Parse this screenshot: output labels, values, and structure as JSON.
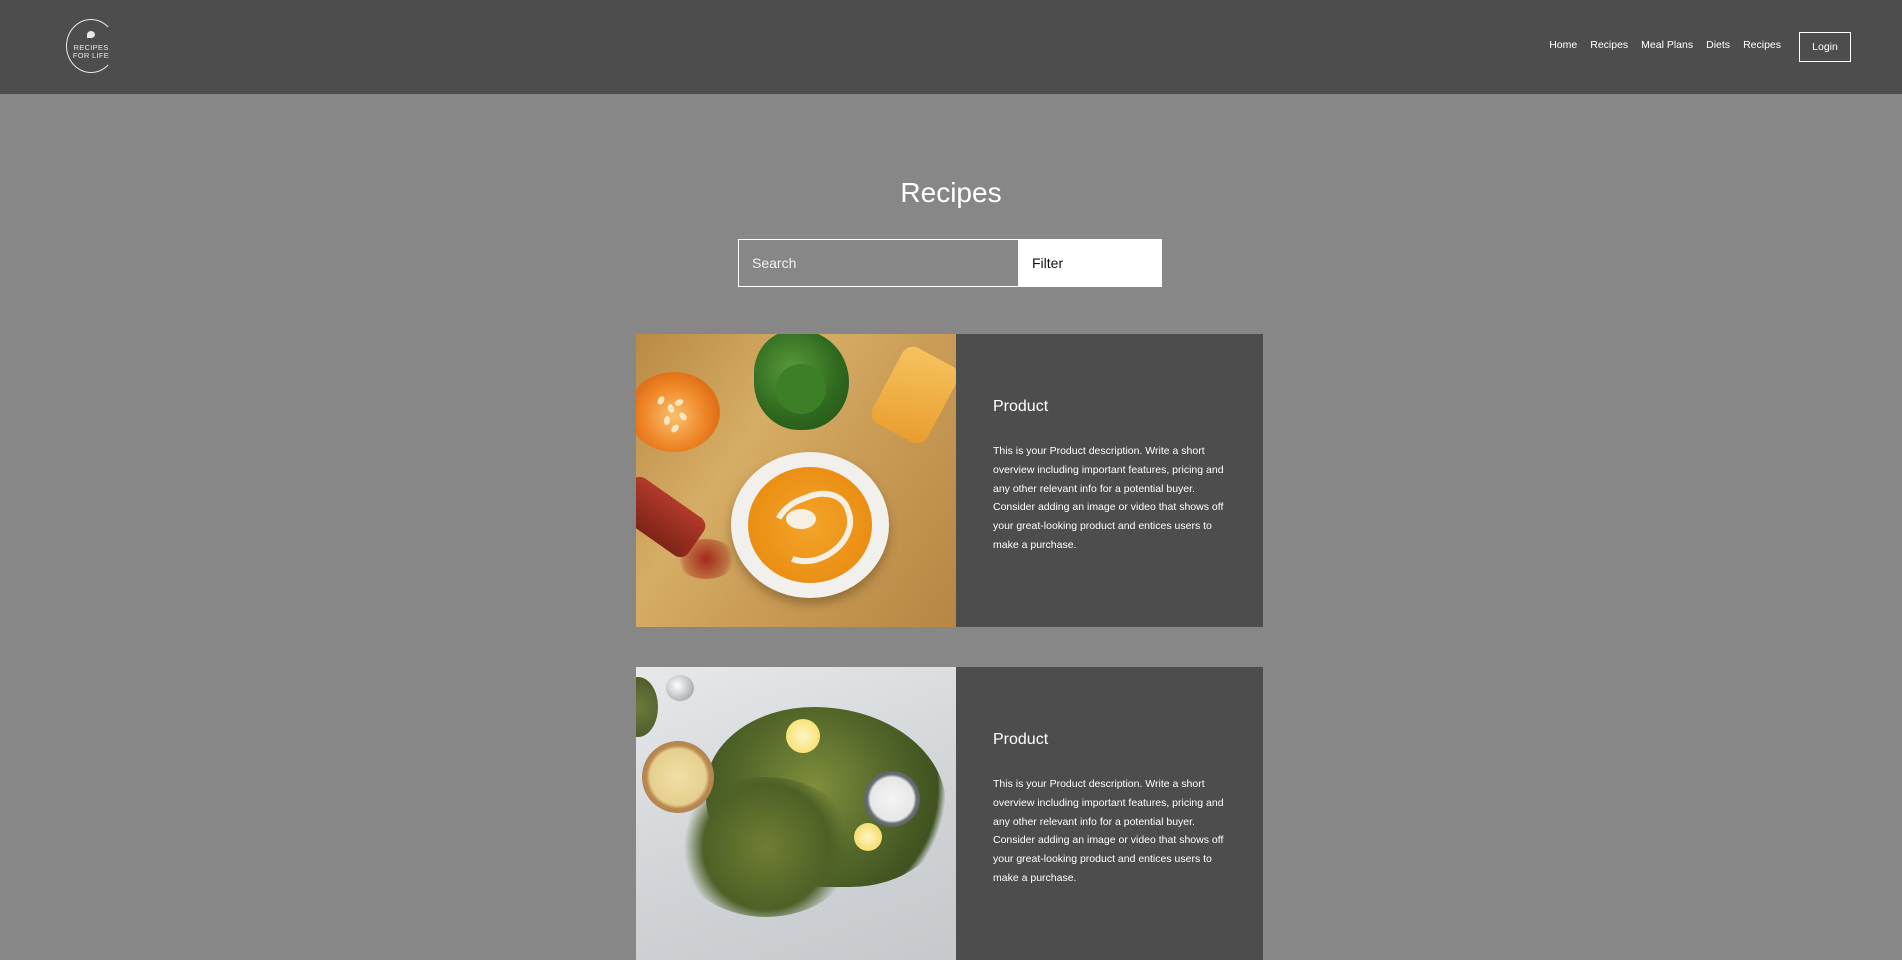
{
  "header": {
    "logo_text": "RECIPES FOR LIFE",
    "nav": [
      "Home",
      "Recipes",
      "Meal Plans",
      "Diets",
      "Recipes"
    ],
    "login_label": "Login"
  },
  "main": {
    "title": "Recipes",
    "search": {
      "placeholder": "Search",
      "value": ""
    },
    "filter_label": "Filter",
    "cards": [
      {
        "image": "butternut-squash-soup-image",
        "title": "Product",
        "description": "This is your Product description. Write a short overview including important features, pricing and any other relevant info for a potential buyer. Consider adding an image or video that shows off your great-looking product and entices users to make a purchase."
      },
      {
        "image": "fried-greens-with-aioli-image",
        "title": "Product",
        "description": "This is your Product description. Write a short overview including important features, pricing and any other relevant info for a potential buyer. Consider adding an image or video that shows off your great-looking product and entices users to make a purchase."
      }
    ]
  },
  "colors": {
    "header_bg": "#4d4d4d",
    "page_bg": "#878787",
    "card_body_bg": "#4d4d4d",
    "text": "#ffffff"
  }
}
